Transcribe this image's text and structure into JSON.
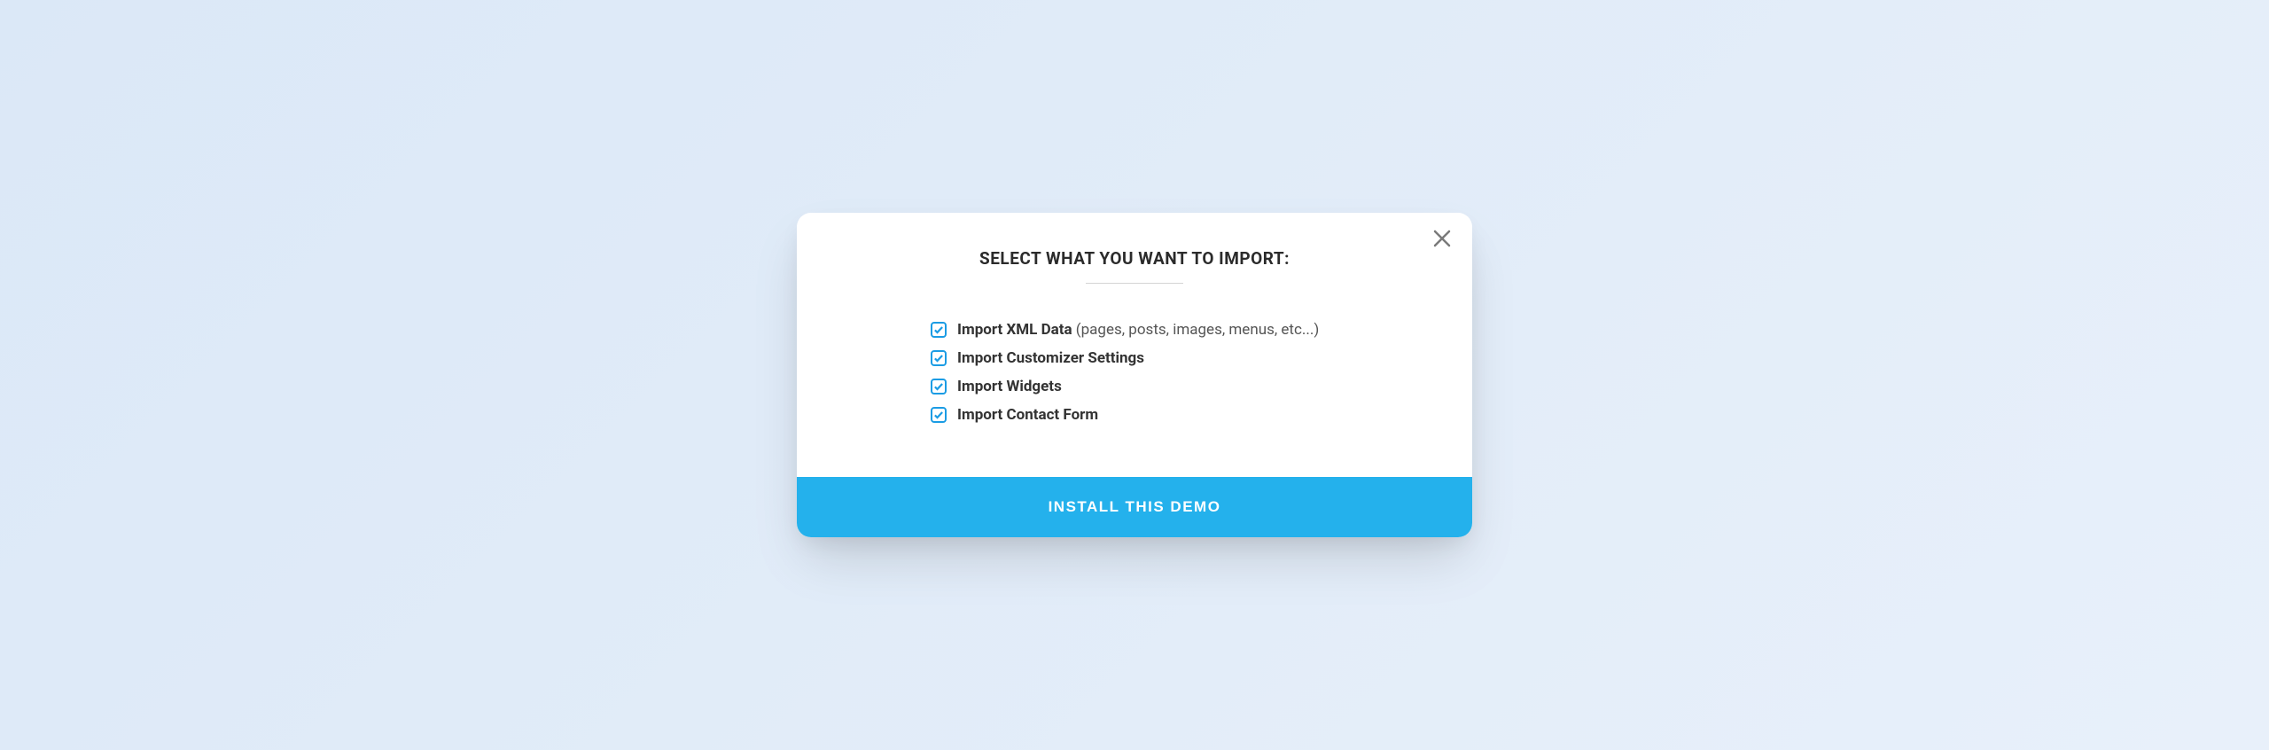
{
  "modal": {
    "title": "SELECT WHAT YOU WANT TO IMPORT:",
    "options": [
      {
        "label": "Import XML Data",
        "hint": " (pages, posts, images, menus, etc...)",
        "checked": true
      },
      {
        "label": "Import Customizer Settings",
        "hint": "",
        "checked": true
      },
      {
        "label": "Import Widgets",
        "hint": "",
        "checked": true
      },
      {
        "label": "Import Contact Form",
        "hint": "",
        "checked": true
      }
    ],
    "install_label": "INSTALL THIS DEMO"
  }
}
